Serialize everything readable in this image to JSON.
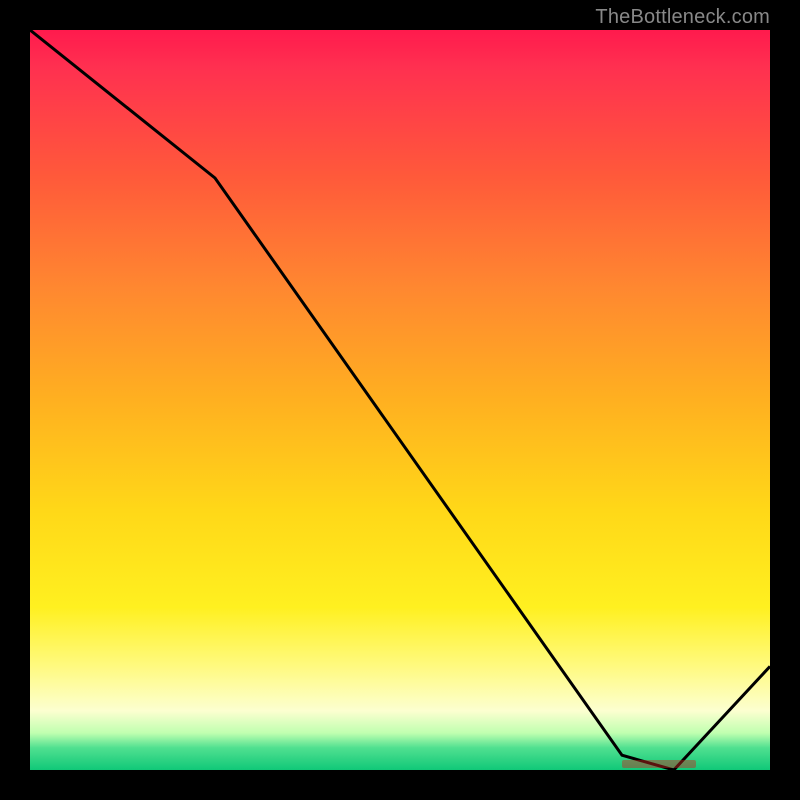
{
  "watermark": "TheBottleneck.com",
  "colors": {
    "page_bg": "#000000",
    "curve_stroke": "#000000",
    "optimal_marker": "rgba(200,40,30,0.45)"
  },
  "chart_data": {
    "type": "line",
    "title": "",
    "xlabel": "",
    "ylabel": "",
    "xlim": [
      0,
      100
    ],
    "ylim": [
      0,
      100
    ],
    "grid": false,
    "legend": false,
    "series": [
      {
        "name": "bottleneck-curve",
        "x": [
          0,
          25,
          80,
          87,
          100
        ],
        "values": [
          100,
          80,
          2,
          0,
          14
        ]
      }
    ],
    "optimal_range_x": [
      80,
      90
    ],
    "gradient_stops": [
      {
        "pos": 0,
        "color": "#ff1a4d"
      },
      {
        "pos": 5,
        "color": "#ff3050"
      },
      {
        "pos": 20,
        "color": "#ff5a3a"
      },
      {
        "pos": 35,
        "color": "#ff8830"
      },
      {
        "pos": 50,
        "color": "#ffb020"
      },
      {
        "pos": 65,
        "color": "#ffd818"
      },
      {
        "pos": 78,
        "color": "#fff020"
      },
      {
        "pos": 86,
        "color": "#fffa80"
      },
      {
        "pos": 92,
        "color": "#fcffd0"
      },
      {
        "pos": 95,
        "color": "#c0ffb0"
      },
      {
        "pos": 97,
        "color": "#50e090"
      },
      {
        "pos": 100,
        "color": "#10c878"
      }
    ]
  }
}
